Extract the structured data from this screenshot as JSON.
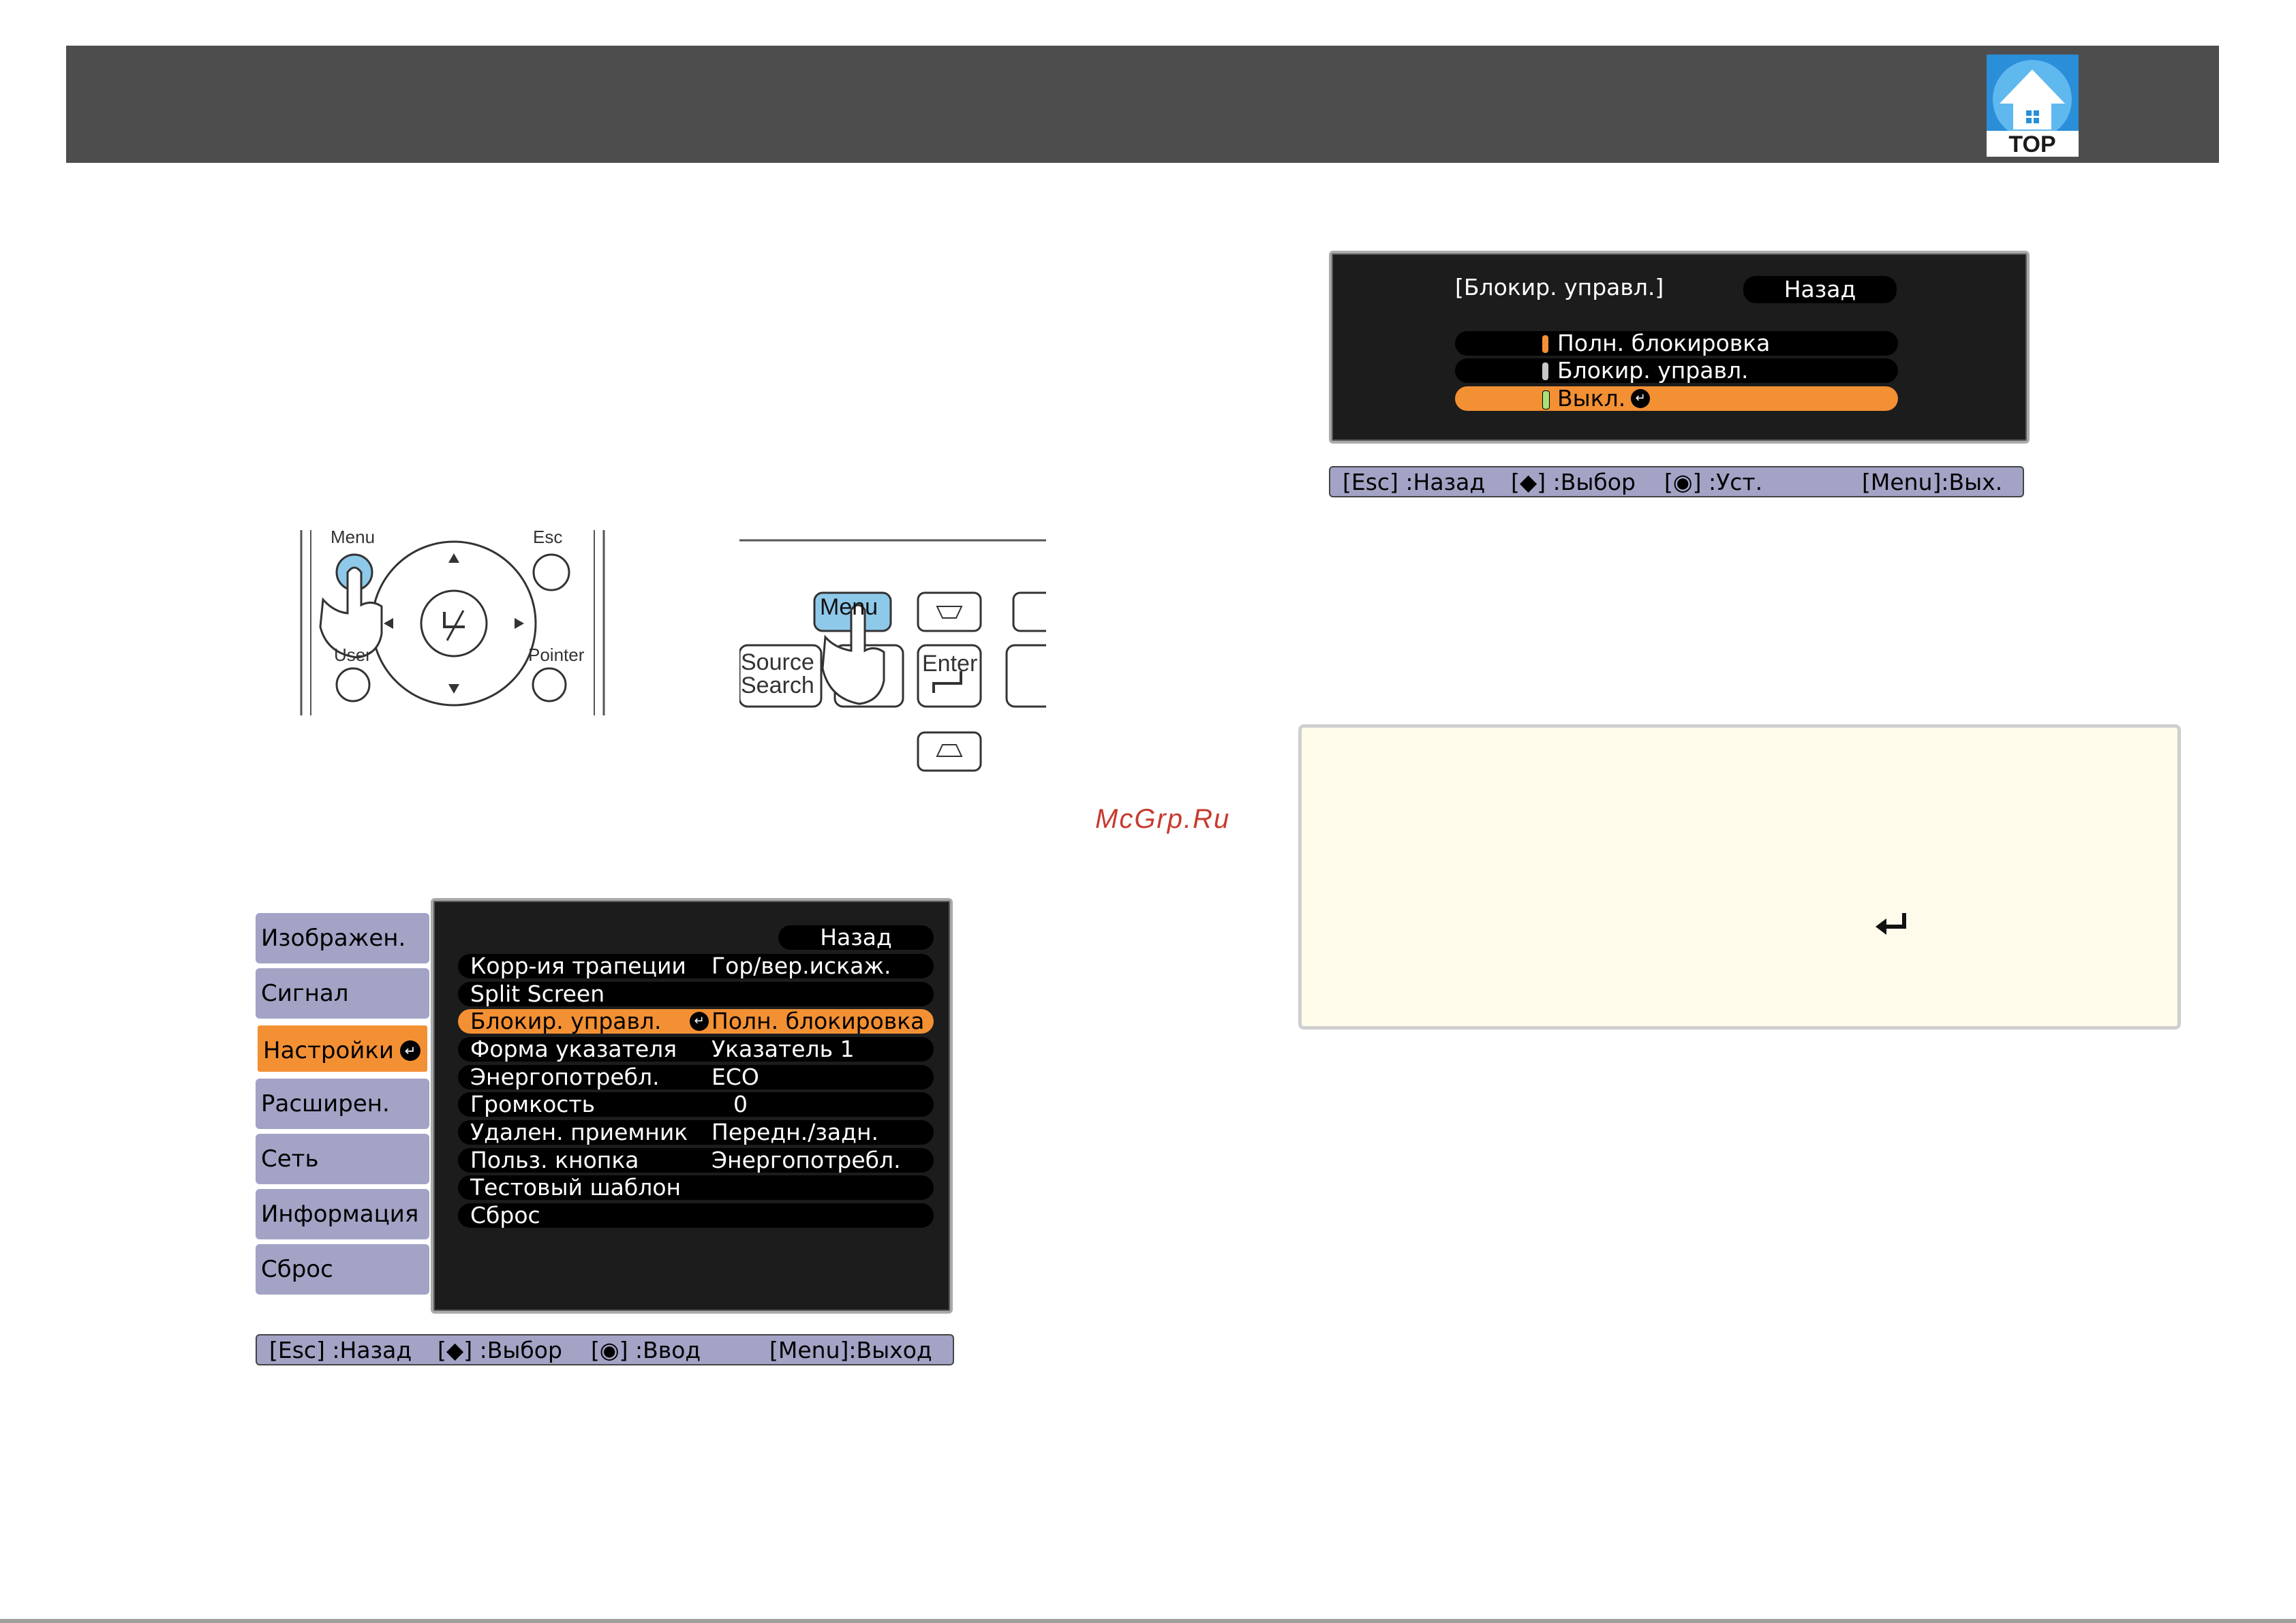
{
  "header": {
    "logo_text": "TOP"
  },
  "remote": {
    "menu": "Menu",
    "esc": "Esc",
    "user": "User",
    "pointer": "Pointer"
  },
  "panel": {
    "menu": "Menu",
    "source": "Source",
    "search": "Search",
    "enter": "Enter"
  },
  "watermark": "McGrp.Ru",
  "main_menu": {
    "back": "Назад",
    "tabs": [
      "Изображен.",
      "Сигнал",
      "Настройки",
      "Расширен.",
      "Сеть",
      "Информация",
      "Сброс"
    ],
    "rows": [
      {
        "label": "Корр-ия трапеции",
        "value": "Гор/вер.искаж."
      },
      {
        "label": "Split Screen",
        "value": ""
      },
      {
        "label": "Блокир. управл.",
        "value": "Полн. блокировка"
      },
      {
        "label": "Форма указателя",
        "value": "Указатель 1"
      },
      {
        "label": "Энергопотребл.",
        "value": "ECO"
      },
      {
        "label": "Громкость",
        "value": "0"
      },
      {
        "label": "Удален. приемник",
        "value": "Передн./задн."
      },
      {
        "label": "Польз. кнопка",
        "value": "Энергопотребл."
      },
      {
        "label": "Тестовый шаблон",
        "value": ""
      },
      {
        "label": "Сброс",
        "value": ""
      }
    ],
    "status": {
      "esc": "[Esc] :Назад",
      "select": "[◆] :Выбор",
      "enter": "[◉] :Ввод",
      "menu": "[Menu]:Выход"
    }
  },
  "lock_menu": {
    "title": "[Блокир. управл.]",
    "back": "Назад",
    "options": [
      "Полн. блокировка",
      "Блокир. управл.",
      "Выкл."
    ],
    "status": {
      "esc": "[Esc] :Назад",
      "select": "[◆] :Выбор",
      "set": "[◉] :Уст.",
      "menu": "[Menu]:Вых."
    }
  },
  "colors": {
    "header": "#4d4d4d",
    "tab": "#a3a3c6",
    "accent": "#f39034",
    "note_bg": "#fffbeb"
  }
}
